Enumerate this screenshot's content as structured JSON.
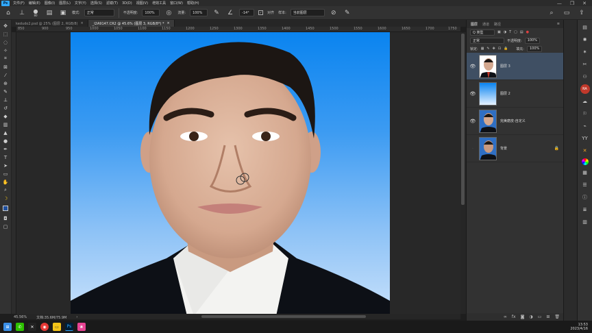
{
  "menubar": {
    "logo": "Ps",
    "items": [
      "文件(F)",
      "编辑(E)",
      "图像(I)",
      "图层(L)",
      "文字(Y)",
      "选择(S)",
      "滤镜(T)",
      "3D(D)",
      "视图(V)",
      "增效工具",
      "窗口(W)",
      "帮助(H)"
    ],
    "minimize": "—",
    "restore": "❐",
    "close": "✕"
  },
  "options": {
    "brush_size": "80",
    "mode_label": "模式:",
    "mode_value": "正常",
    "opacity_label": "不透明度:",
    "opacity_value": "100%",
    "flow_label": "流量:",
    "flow_value": "100%",
    "angle_value": "-14°",
    "align_label": "对齐",
    "sample_label": "样本:",
    "sample_value": "当前图层"
  },
  "tabs": [
    {
      "label": "kedudo2.psd @ 25% (图层 2, RGB/8)",
      "close": "×",
      "active": false
    },
    {
      "label": "_I2A9147.CR2 @ 45.6% (图层 3, RGB/8*) *",
      "close": "×",
      "active": true
    }
  ],
  "ruler": [
    "850",
    "900",
    "950",
    "1000",
    "1050",
    "1100",
    "1150",
    "1200",
    "1250",
    "1300",
    "1350",
    "1400",
    "1450",
    "1500",
    "1550",
    "1600",
    "1650",
    "1700",
    "1750"
  ],
  "status": {
    "zoom": "45.56%",
    "doc": "文档:35.6M/75.9M"
  },
  "layers_panel": {
    "tabs": [
      "图层",
      "通道",
      "路径"
    ],
    "kind_label": "Q 类型",
    "blend_mode": "正常",
    "opacity_label": "不透明度:",
    "opacity_value": "100%",
    "lock_label": "锁定:",
    "fill_label": "填充:",
    "fill_value": "100%",
    "layers": [
      {
        "name": "图层 3",
        "selected": true,
        "visible": true
      },
      {
        "name": "图层 2",
        "selected": false,
        "visible": true
      },
      {
        "name": "完美磨皮-自定义",
        "selected": false,
        "visible": true
      },
      {
        "name": "背景",
        "selected": false,
        "visible": false,
        "locked": true
      }
    ],
    "footer_icons": [
      "link-icon",
      "fx-icon",
      "mask-icon",
      "adjustment-icon",
      "folder-icon",
      "new-layer-icon",
      "trash-icon"
    ]
  },
  "taskbar": {
    "time": "13:53",
    "date": "2023/4/16"
  },
  "colors": {
    "accent": "#31a8ff",
    "selected_layer": "#3f4f63",
    "panel": "#323232",
    "foreground_swatch": "#1f4f9e"
  }
}
